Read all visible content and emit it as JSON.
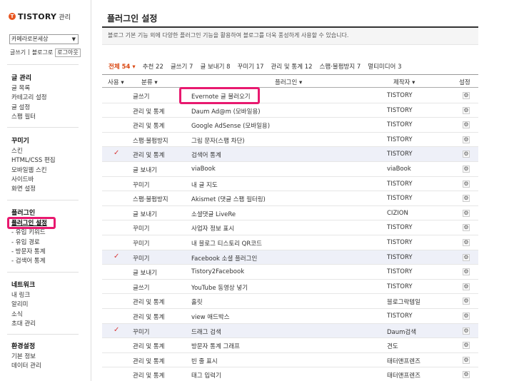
{
  "logo": {
    "mark": "T",
    "brand": "TISTORY",
    "sub": "관리"
  },
  "blog_select": {
    "value": "카메라로본세상"
  },
  "top_links": [
    "글쓰기",
    "블로그로",
    "로그아웃"
  ],
  "sidebar": {
    "sections": [
      {
        "title": "글 관리",
        "items": [
          "글 목록",
          "카테고리 설정",
          "글 설정",
          "스팸 필터"
        ]
      },
      {
        "title": "꾸미기",
        "items": [
          "스킨",
          "HTML/CSS 편집",
          "모바일웹 스킨",
          "사이드바",
          "화면 설정"
        ]
      },
      {
        "title": "플러그인",
        "items": [
          "플러그인 설정",
          "- 유입 키워드",
          "- 유입 경로",
          "- 방문자 통계",
          "- 검색어 통계"
        ]
      },
      {
        "title": "네트워크",
        "items": [
          "내 링크",
          "알리미",
          "소식",
          "초대 관리"
        ]
      },
      {
        "title": "환경설정",
        "items": [
          "기본 정보",
          "데이터 관리"
        ]
      }
    ]
  },
  "page": {
    "title": "플러그인 설정",
    "description": "블로그 기본 기능 외에 다양한 플러그인 기능을 활용하여 블로그를 더욱 풍성하게 사용할 수 있습니다."
  },
  "filters": [
    {
      "label": "전체 54",
      "active": true
    },
    {
      "label": "추천 22"
    },
    {
      "label": "글쓰기 7"
    },
    {
      "label": "글 보내기 8"
    },
    {
      "label": "꾸미기 17"
    },
    {
      "label": "관리 및 통계 12"
    },
    {
      "label": "스팸·불펌방지 7"
    },
    {
      "label": "멀티미디어 3"
    }
  ],
  "table": {
    "headers": {
      "use": "사용",
      "category": "분류",
      "plugin": "플러그인",
      "maker": "제작자",
      "settings": "설정"
    },
    "rows": [
      {
        "used": false,
        "category": "글쓰기",
        "name": "Evernote 글 불러오기",
        "maker": "TISTORY"
      },
      {
        "used": false,
        "category": "관리 및 통계",
        "name": "Daum Ad@m (모바일용)",
        "maker": "TISTORY"
      },
      {
        "used": false,
        "category": "관리 및 통계",
        "name": "Google AdSense (모바일용)",
        "maker": "TISTORY"
      },
      {
        "used": false,
        "category": "스팸·불펌방지",
        "name": "그림 문자(스팸 차단)",
        "maker": "TISTORY"
      },
      {
        "used": true,
        "category": "관리 및 통계",
        "name": "검색어 통계",
        "maker": "TISTORY"
      },
      {
        "used": false,
        "category": "글 보내기",
        "name": "viaBook",
        "maker": "viaBook"
      },
      {
        "used": false,
        "category": "꾸미기",
        "name": "내 글 지도",
        "maker": "TISTORY"
      },
      {
        "used": false,
        "category": "스팸·불펌방지",
        "name": "Akismet (댓글 스팸 필터링)",
        "maker": "TISTORY"
      },
      {
        "used": false,
        "category": "글 보내기",
        "name": "소셜댓글 LiveRe",
        "maker": "CIZION"
      },
      {
        "used": false,
        "category": "꾸미기",
        "name": "사업자 정보 표시",
        "maker": "TISTORY"
      },
      {
        "used": false,
        "category": "꾸미기",
        "name": "내 블로그 티스토리 QR코드",
        "maker": "TISTORY"
      },
      {
        "used": true,
        "category": "꾸미기",
        "name": "Facebook 소셜 플러그인",
        "maker": "TISTORY"
      },
      {
        "used": false,
        "category": "글 보내기",
        "name": "Tistory2Facebook",
        "maker": "TISTORY"
      },
      {
        "used": false,
        "category": "글쓰기",
        "name": "YouTube 동영상 넣기",
        "maker": "TISTORY"
      },
      {
        "used": false,
        "category": "관리 및 통계",
        "name": "홀릿",
        "maker": "블로그락템일"
      },
      {
        "used": false,
        "category": "관리 및 통계",
        "name": "view 애드박스",
        "maker": "TISTORY"
      },
      {
        "used": true,
        "category": "꾸미기",
        "name": "드래그 검색",
        "maker": "Daum검색"
      },
      {
        "used": false,
        "category": "관리 및 통계",
        "name": "방문자 통계 그래프",
        "maker": "견도"
      },
      {
        "used": false,
        "category": "관리 및 통계",
        "name": "빈 줄 표시",
        "maker": "태터앤프렌즈"
      },
      {
        "used": false,
        "category": "관리 및 통계",
        "name": "태그 입력기",
        "maker": "태터앤프렌즈"
      }
    ]
  },
  "icons": {
    "check": "check-icon",
    "settings": "gear-icon",
    "dropdown": "chevron-down-icon"
  },
  "colors": {
    "highlight": "#e8196f",
    "accent": "#d9450f",
    "check": "#d83a3a",
    "selected_row": "#eef0f8"
  }
}
